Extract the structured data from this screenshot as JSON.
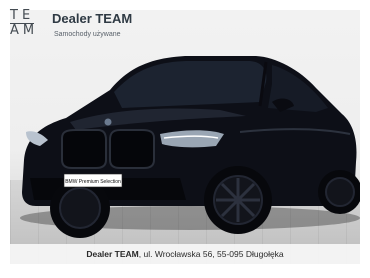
{
  "brand": {
    "logo_lines": [
      "TE",
      "AM"
    ],
    "name": "Dealer TEAM",
    "tagline": "Samochody używane"
  },
  "vehicle": {
    "plate_text": "BMW Premium Selection",
    "body_color": "#0d0f17"
  },
  "footer": {
    "dealer_name": "Dealer TEAM",
    "address": ", ul. Wrocławska 56, 55-095 Długołęka"
  },
  "colors": {
    "brand_text": "#2f3a44",
    "background": "#f0f0f0"
  }
}
